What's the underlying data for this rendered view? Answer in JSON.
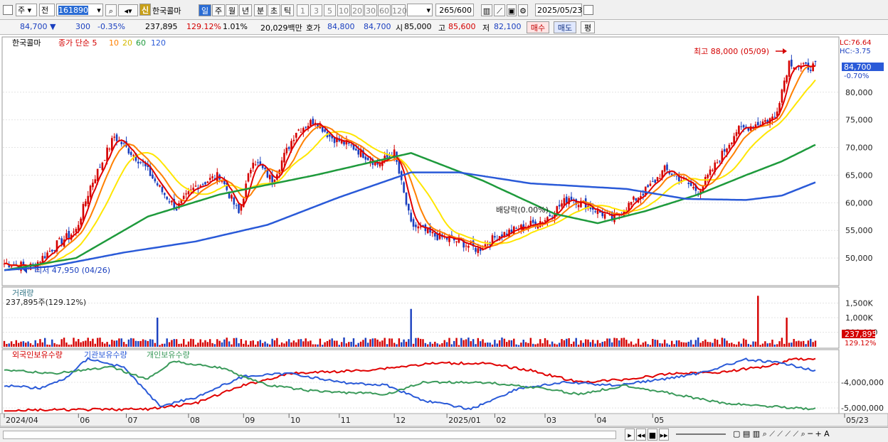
{
  "toolbar": {
    "period_type": "주",
    "prev_label": "전",
    "code": "161890",
    "stock_badge": "신",
    "stock_name": "한국콜마",
    "period_buttons": [
      "일",
      "주",
      "월",
      "년",
      "분",
      "초",
      "틱"
    ],
    "active_period": "일",
    "interval_buttons": [
      "1",
      "3",
      "5",
      "10",
      "20",
      "30",
      "60",
      "120"
    ],
    "count_value": "265",
    "count_max": "/600",
    "date": "2025/05/23"
  },
  "quote": {
    "price": "84,700",
    "change": "300",
    "change_pct": "-0.35%",
    "volume": "237,895",
    "volume_pct": "129.12%",
    "turnover": "1.01%",
    "amount": "20,029백만",
    "ask_label": "호가",
    "ask": "84,800",
    "bid": "84,700",
    "open_label": "시",
    "open": "85,000",
    "high_label": "고",
    "high": "85,600",
    "low_label": "저",
    "low": "82,100",
    "buy_label": "매수",
    "sell_label": "매도",
    "eval_label": "평"
  },
  "colors": {
    "up": "#d40000",
    "down": "#1a3fbf",
    "ma5": "#e00000",
    "ma10": "#ff8000",
    "ma20": "#ffe600",
    "ma60": "#1e9a3c",
    "ma120": "#2a5ad8",
    "foreign": "#e00000",
    "institution": "#2a5ad8",
    "individual": "#3a9a5a"
  },
  "chart_data": [
    {
      "type": "candlestick",
      "title": "한국콜마",
      "legend": {
        "prefix": "종가 단순",
        "periods": [
          "5",
          "10",
          "20",
          "60",
          "120"
        ]
      },
      "lc_label": "LC:76.64",
      "hc_label": "HC:-3.75",
      "price_tag": "84,700",
      "price_tag_pct": "-0.70%",
      "ylim": [
        45000,
        90000
      ],
      "y_ticks": [
        {
          "v": 80000,
          "label": "80,000"
        },
        {
          "v": 75000,
          "label": "75,000"
        },
        {
          "v": 70000,
          "label": "70,000"
        },
        {
          "v": 65000,
          "label": "65,000"
        },
        {
          "v": 60000,
          "label": "60,000"
        },
        {
          "v": 55000,
          "label": "55,000"
        },
        {
          "v": 50000,
          "label": "50,000"
        }
      ],
      "annotations": {
        "high": "최고 88,000 (05/09)",
        "low": "최저 47,950 (04/26)",
        "dividend": "배당락(0.00%)"
      },
      "close_anchors": [
        {
          "i": 0,
          "v": 49000
        },
        {
          "i": 12,
          "v": 48500
        },
        {
          "i": 22,
          "v": 52500
        },
        {
          "i": 30,
          "v": 55000
        },
        {
          "i": 36,
          "v": 63000
        },
        {
          "i": 46,
          "v": 72000
        },
        {
          "i": 58,
          "v": 67000
        },
        {
          "i": 66,
          "v": 62000
        },
        {
          "i": 72,
          "v": 59000
        },
        {
          "i": 80,
          "v": 63000
        },
        {
          "i": 90,
          "v": 65000
        },
        {
          "i": 98,
          "v": 58000
        },
        {
          "i": 104,
          "v": 68000
        },
        {
          "i": 112,
          "v": 64000
        },
        {
          "i": 122,
          "v": 73000
        },
        {
          "i": 130,
          "v": 75000
        },
        {
          "i": 136,
          "v": 72000
        },
        {
          "i": 146,
          "v": 70000
        },
        {
          "i": 156,
          "v": 67000
        },
        {
          "i": 163,
          "v": 69000
        },
        {
          "i": 170,
          "v": 56000
        },
        {
          "i": 180,
          "v": 54000
        },
        {
          "i": 190,
          "v": 53000
        },
        {
          "i": 198,
          "v": 51500
        },
        {
          "i": 206,
          "v": 54000
        },
        {
          "i": 216,
          "v": 55500
        },
        {
          "i": 226,
          "v": 57000
        },
        {
          "i": 236,
          "v": 61000
        },
        {
          "i": 246,
          "v": 59000
        },
        {
          "i": 254,
          "v": 57000
        },
        {
          "i": 262,
          "v": 60000
        },
        {
          "i": 270,
          "v": 63000
        },
        {
          "i": 276,
          "v": 66000
        },
        {
          "i": 284,
          "v": 64000
        },
        {
          "i": 290,
          "v": 62000
        },
        {
          "i": 296,
          "v": 66000
        },
        {
          "i": 306,
          "v": 73000
        },
        {
          "i": 316,
          "v": 74500
        },
        {
          "i": 322,
          "v": 75500
        },
        {
          "i": 328,
          "v": 85500
        },
        {
          "i": 333,
          "v": 84500
        },
        {
          "i": 339,
          "v": 84700
        }
      ],
      "ma60_anchors": [
        {
          "i": 0,
          "v": 47800
        },
        {
          "i": 30,
          "v": 50000
        },
        {
          "i": 60,
          "v": 57500
        },
        {
          "i": 90,
          "v": 61500
        },
        {
          "i": 130,
          "v": 65000
        },
        {
          "i": 170,
          "v": 69000
        },
        {
          "i": 200,
          "v": 64000
        },
        {
          "i": 230,
          "v": 58000
        },
        {
          "i": 248,
          "v": 56300
        },
        {
          "i": 268,
          "v": 58500
        },
        {
          "i": 290,
          "v": 61500
        },
        {
          "i": 310,
          "v": 65000
        },
        {
          "i": 325,
          "v": 67500
        },
        {
          "i": 339,
          "v": 70500
        }
      ],
      "ma120_anchors": [
        {
          "i": 0,
          "v": 47800
        },
        {
          "i": 20,
          "v": 48500
        },
        {
          "i": 50,
          "v": 51000
        },
        {
          "i": 80,
          "v": 53000
        },
        {
          "i": 110,
          "v": 56000
        },
        {
          "i": 140,
          "v": 61000
        },
        {
          "i": 170,
          "v": 65500
        },
        {
          "i": 190,
          "v": 65500
        },
        {
          "i": 220,
          "v": 63500
        },
        {
          "i": 260,
          "v": 62500
        },
        {
          "i": 285,
          "v": 60700
        },
        {
          "i": 310,
          "v": 60500
        },
        {
          "i": 325,
          "v": 61300
        },
        {
          "i": 339,
          "v": 63700
        }
      ]
    },
    {
      "type": "bar",
      "title": "거래량",
      "subtitle": "237,895주(129.12%)",
      "ylim": [
        0,
        2000
      ],
      "unit": "K",
      "y_ticks": [
        {
          "v": 1500,
          "label": "1,500K"
        },
        {
          "v": 1000,
          "label": "1,000K"
        },
        {
          "v": 500,
          "label": "500,000"
        }
      ],
      "last_tag": "237,895",
      "last_tag_pct": "129.12%",
      "spikes": [
        {
          "i": 64,
          "v": 1000
        },
        {
          "i": 170,
          "v": 1300
        },
        {
          "i": 315,
          "v": 1750
        },
        {
          "i": 327,
          "v": 1000
        }
      ]
    },
    {
      "type": "line",
      "legend": [
        "외국인보유수량",
        "기관보유수량",
        "개인보유수량"
      ],
      "y_ticks": [
        {
          "v": -4000000,
          "label": "-4,000,000"
        },
        {
          "v": -5000000,
          "label": "-5,000,000"
        }
      ],
      "series": [
        {
          "name": "외국인보유수량",
          "anchors": [
            {
              "i": 0,
              "v": 0.97
            },
            {
              "i": 30,
              "v": 0.96
            },
            {
              "i": 60,
              "v": 0.95
            },
            {
              "i": 80,
              "v": 0.85
            },
            {
              "i": 100,
              "v": 0.55
            },
            {
              "i": 120,
              "v": 0.35
            },
            {
              "i": 150,
              "v": 0.3
            },
            {
              "i": 180,
              "v": 0.18
            },
            {
              "i": 200,
              "v": 0.18
            },
            {
              "i": 220,
              "v": 0.3
            },
            {
              "i": 240,
              "v": 0.5
            },
            {
              "i": 260,
              "v": 0.45
            },
            {
              "i": 280,
              "v": 0.35
            },
            {
              "i": 300,
              "v": 0.33
            },
            {
              "i": 320,
              "v": 0.22
            },
            {
              "i": 330,
              "v": 0.1
            },
            {
              "i": 339,
              "v": 0.12
            }
          ]
        },
        {
          "name": "기관보유수량",
          "anchors": [
            {
              "i": 0,
              "v": 0.55
            },
            {
              "i": 15,
              "v": 0.6
            },
            {
              "i": 25,
              "v": 0.45
            },
            {
              "i": 35,
              "v": 0.1
            },
            {
              "i": 50,
              "v": 0.25
            },
            {
              "i": 65,
              "v": 0.9
            },
            {
              "i": 80,
              "v": 0.75
            },
            {
              "i": 100,
              "v": 0.4
            },
            {
              "i": 120,
              "v": 0.35
            },
            {
              "i": 140,
              "v": 0.5
            },
            {
              "i": 160,
              "v": 0.55
            },
            {
              "i": 175,
              "v": 0.8
            },
            {
              "i": 195,
              "v": 0.95
            },
            {
              "i": 215,
              "v": 0.6
            },
            {
              "i": 235,
              "v": 0.5
            },
            {
              "i": 255,
              "v": 0.55
            },
            {
              "i": 275,
              "v": 0.45
            },
            {
              "i": 290,
              "v": 0.35
            },
            {
              "i": 310,
              "v": 0.12
            },
            {
              "i": 325,
              "v": 0.18
            },
            {
              "i": 339,
              "v": 0.3
            }
          ]
        },
        {
          "name": "개인보유수량",
          "anchors": [
            {
              "i": 0,
              "v": 0.3
            },
            {
              "i": 20,
              "v": 0.35
            },
            {
              "i": 45,
              "v": 0.25
            },
            {
              "i": 60,
              "v": 0.45
            },
            {
              "i": 70,
              "v": 0.15
            },
            {
              "i": 90,
              "v": 0.25
            },
            {
              "i": 110,
              "v": 0.55
            },
            {
              "i": 130,
              "v": 0.65
            },
            {
              "i": 160,
              "v": 0.7
            },
            {
              "i": 175,
              "v": 0.5
            },
            {
              "i": 200,
              "v": 0.5
            },
            {
              "i": 225,
              "v": 0.6
            },
            {
              "i": 240,
              "v": 0.7
            },
            {
              "i": 260,
              "v": 0.55
            },
            {
              "i": 280,
              "v": 0.7
            },
            {
              "i": 300,
              "v": 0.85
            },
            {
              "i": 320,
              "v": 0.9
            },
            {
              "i": 339,
              "v": 0.95
            }
          ]
        }
      ]
    }
  ],
  "x_axis": {
    "labels": [
      {
        "i": 0,
        "label": "2024/04"
      },
      {
        "i": 31,
        "label": "06"
      },
      {
        "i": 51,
        "label": "07"
      },
      {
        "i": 77,
        "label": "08"
      },
      {
        "i": 100,
        "label": "09"
      },
      {
        "i": 119,
        "label": "10"
      },
      {
        "i": 140,
        "label": "11"
      },
      {
        "i": 163,
        "label": "12"
      },
      {
        "i": 185,
        "label": "2025/01"
      },
      {
        "i": 205,
        "label": "02"
      },
      {
        "i": 226,
        "label": "03"
      },
      {
        "i": 247,
        "label": "04"
      },
      {
        "i": 271,
        "label": "05"
      },
      {
        "i": 296,
        "label": "05/23"
      }
    ]
  }
}
